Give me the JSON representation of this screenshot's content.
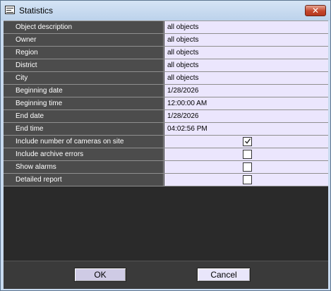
{
  "window": {
    "title": "Statistics",
    "close_glyph": "✕",
    "app_icon": "window-icon",
    "accent_color": "#c9dbf0",
    "close_color": "#c4452b"
  },
  "rows": [
    {
      "label": "Object description",
      "value": "all objects"
    },
    {
      "label": "Owner",
      "value": "all objects"
    },
    {
      "label": "Region",
      "value": "all objects"
    },
    {
      "label": "District",
      "value": "all objects"
    },
    {
      "label": "City",
      "value": "all objects"
    },
    {
      "label": "Beginning date",
      "value": "1/28/2026"
    },
    {
      "label": "Beginning time",
      "value": "12:00:00 AM"
    },
    {
      "label": "End date",
      "value": "1/28/2026"
    },
    {
      "label": "End time",
      "value": "04:02:56 PM"
    }
  ],
  "checkbox_rows": [
    {
      "label": "Include number of cameras on site",
      "checked": true
    },
    {
      "label": "Include archive errors",
      "checked": false
    },
    {
      "label": "Show alarms",
      "checked": false
    },
    {
      "label": "Detailed report",
      "checked": false
    }
  ],
  "buttons": {
    "ok_label": "OK",
    "cancel_label": "Cancel"
  }
}
